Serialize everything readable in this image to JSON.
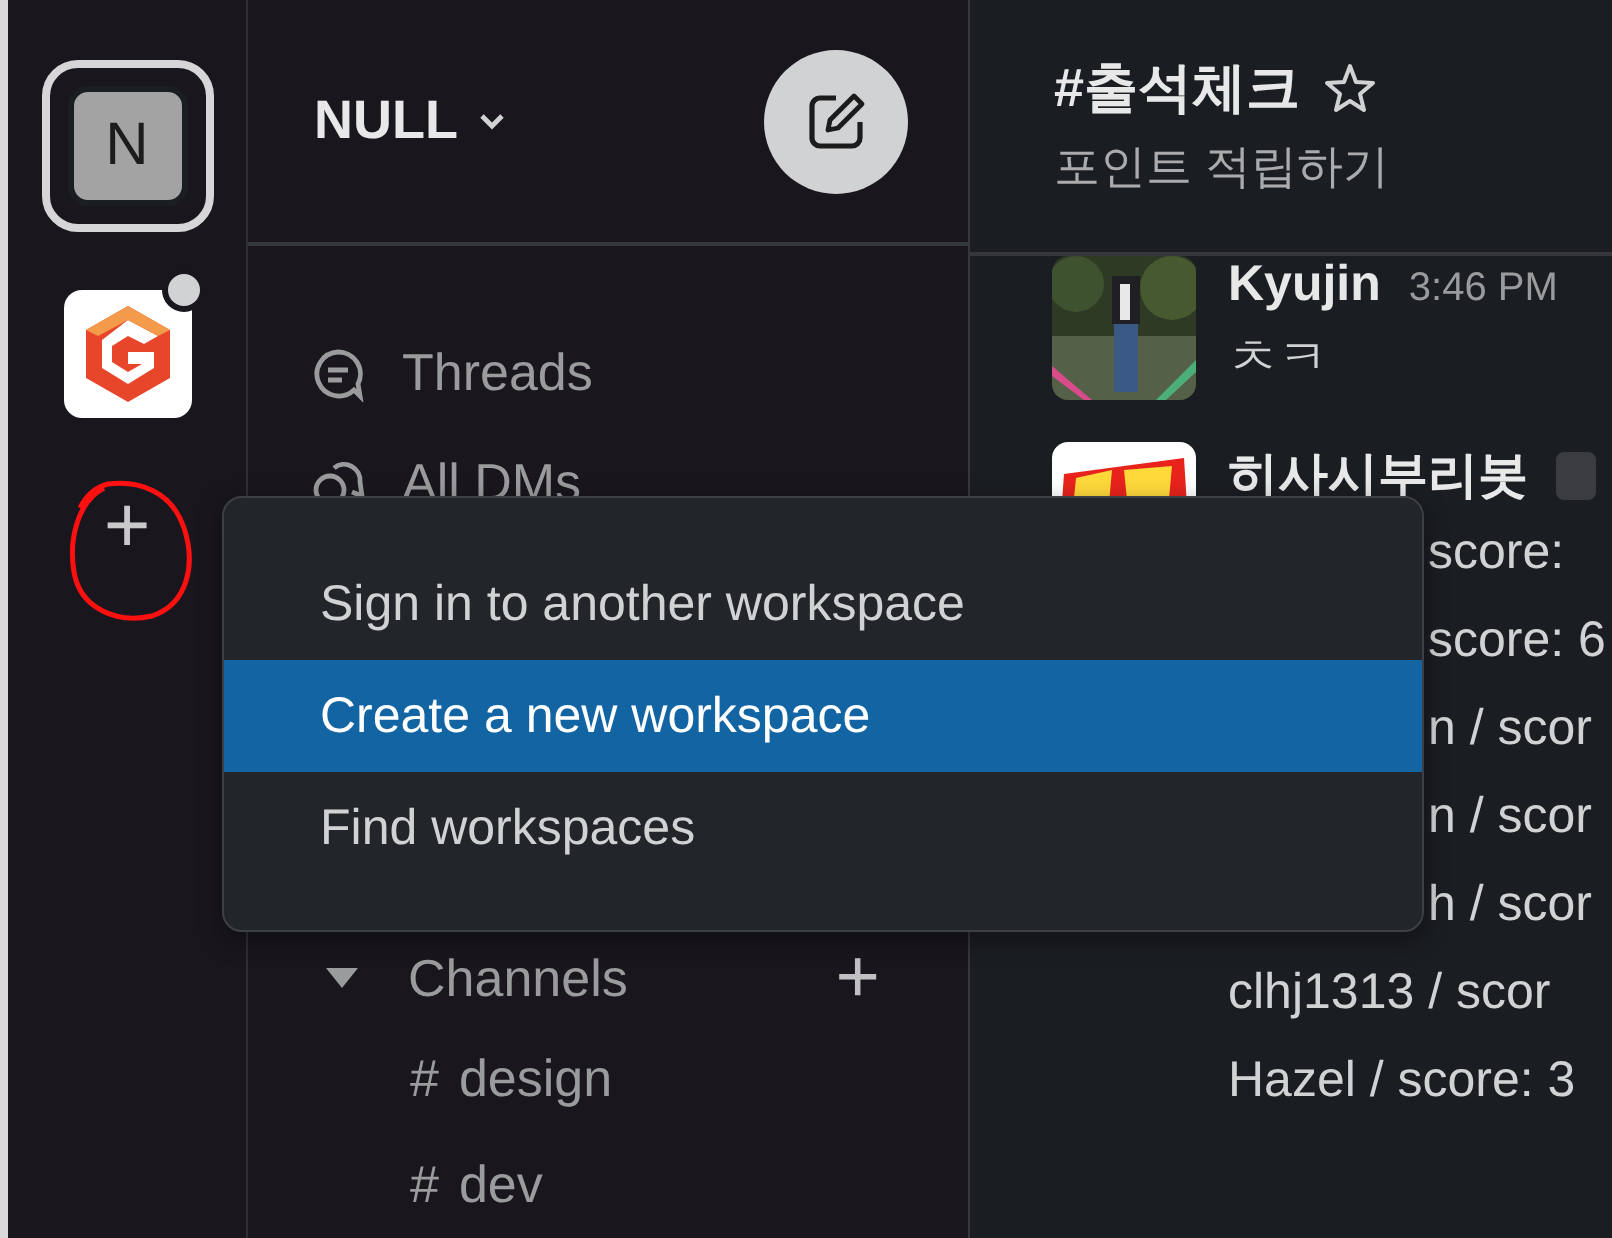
{
  "workspaces": [
    {
      "kind": "initial",
      "label": "N",
      "selected": true,
      "unread": false
    },
    {
      "kind": "logo",
      "selected": false,
      "unread": true
    }
  ],
  "add_workspace": {
    "label": "+"
  },
  "sidebar": {
    "workspace_name": "NULL",
    "nav": [
      {
        "kind": "threads",
        "label": "Threads"
      },
      {
        "kind": "dms",
        "label": "All DMs"
      }
    ],
    "channels_section": {
      "label": "Channels",
      "expanded": true,
      "add": "+"
    },
    "channels": [
      {
        "hash": "#",
        "name": "design"
      },
      {
        "hash": "#",
        "name": "dev"
      }
    ]
  },
  "channel": {
    "title": "#출석체크",
    "starred": false,
    "topic": "포인트 적립하기"
  },
  "messages": [
    {
      "author": "Kyujin",
      "time": "3:46 PM",
      "bot_badge": false,
      "lines": [
        {
          "text": "ㅊㅋ",
          "covered": false
        }
      ]
    },
    {
      "author": "히사시부리봇",
      "bot_badge": true,
      "lines": [
        {
          "text": "score:",
          "covered": true
        },
        {
          "text": "score: 6",
          "covered": true
        },
        {
          "text": "n / scor",
          "covered": true
        },
        {
          "text": "n / scor",
          "covered": true
        },
        {
          "text": "h / scor",
          "covered": true
        },
        {
          "text": "clhj1313 / scor",
          "covered": false
        },
        {
          "text": "Hazel / score: 3",
          "covered": false
        }
      ]
    }
  ],
  "menu": {
    "items": [
      {
        "label": "Sign in to another workspace",
        "selected": false
      },
      {
        "label": "Create a new workspace",
        "selected": true
      },
      {
        "label": "Find workspaces",
        "selected": false
      }
    ]
  }
}
